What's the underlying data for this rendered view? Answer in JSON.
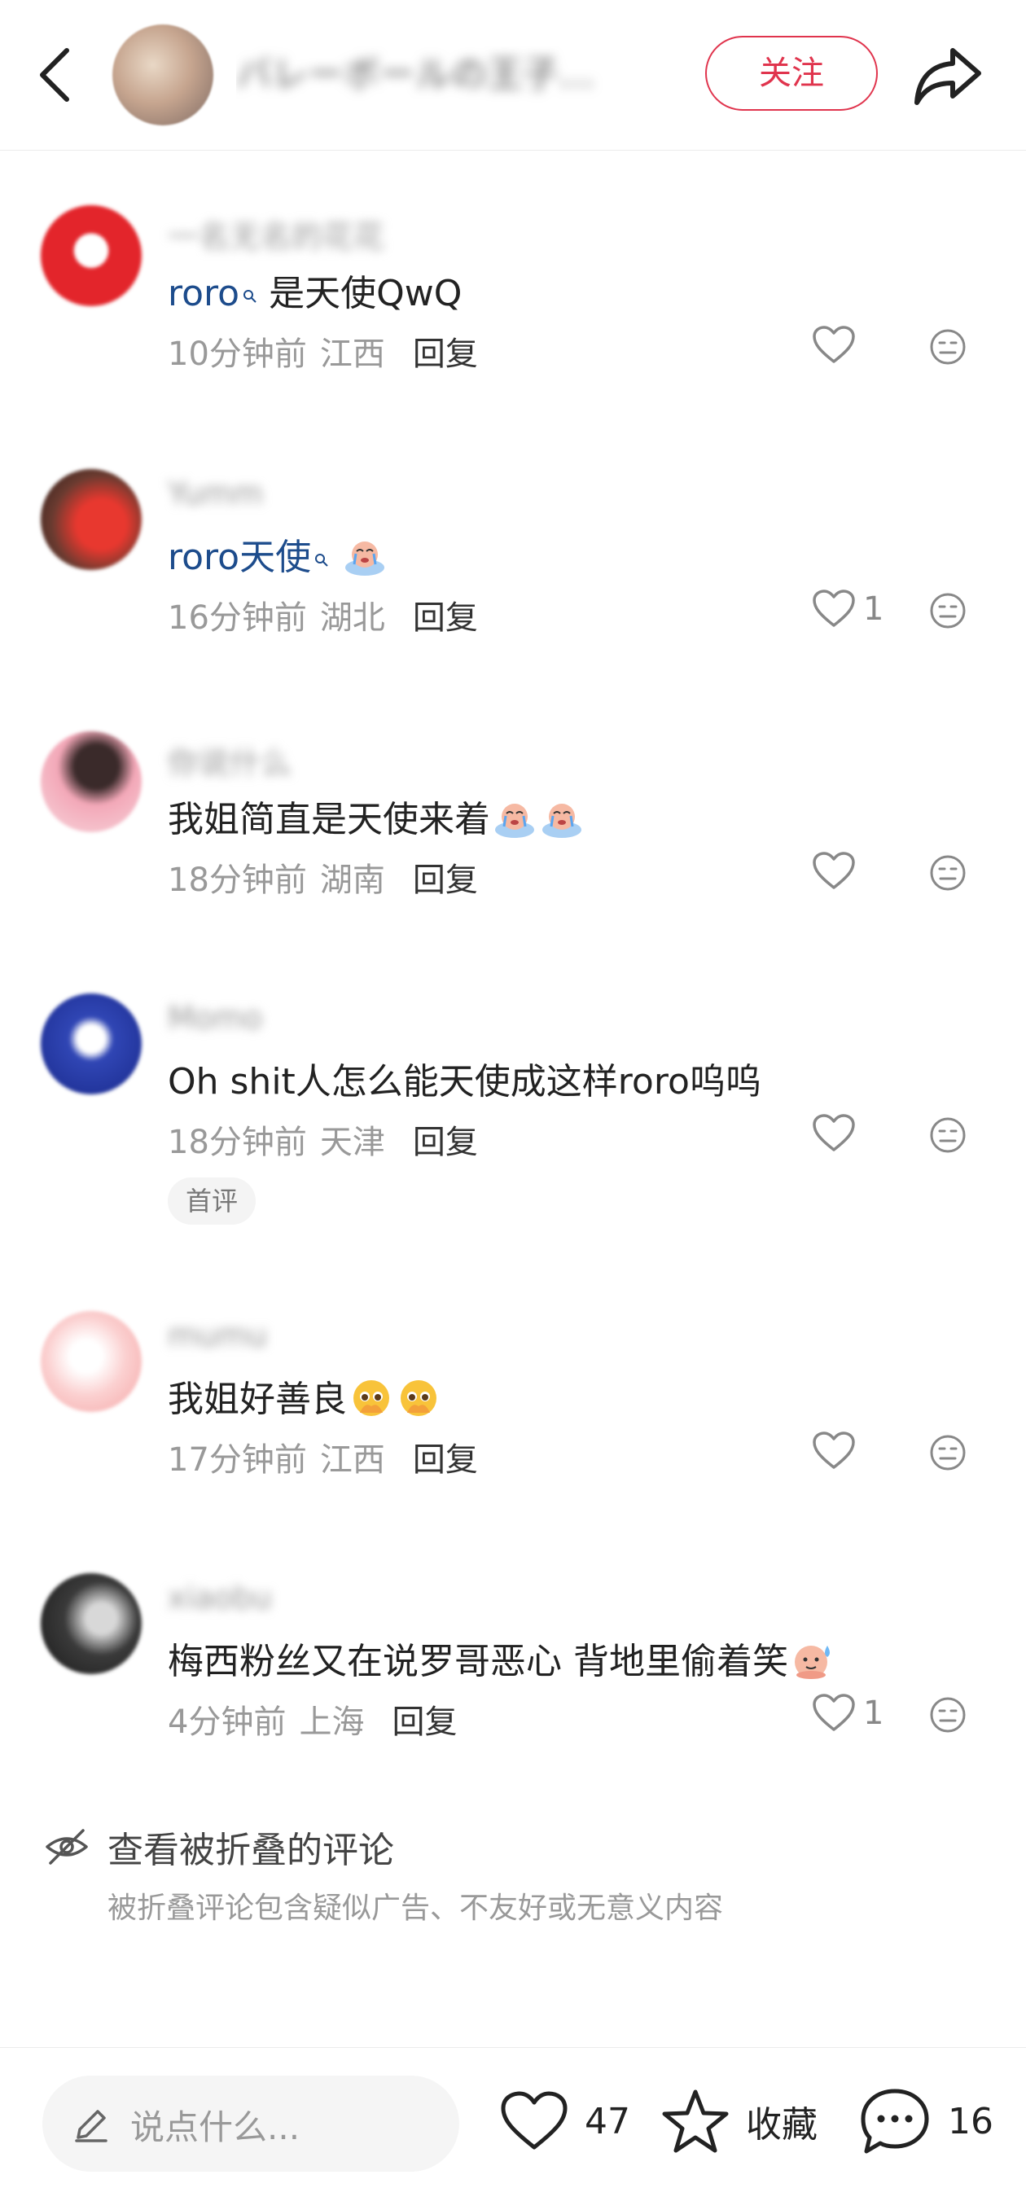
{
  "header": {
    "author_name": "バレーボールの王子…",
    "follow_label": "关注"
  },
  "comments": [
    {
      "username": "一名无名的花花",
      "mention": "roro",
      "text": "是天使QwQ",
      "time": "10分钟前",
      "location": "江西",
      "reply_label": "回复",
      "like_count": "",
      "emojis": []
    },
    {
      "username": "Yumm",
      "mention": "roro天使",
      "text": "",
      "time": "16分钟前",
      "location": "湖北",
      "reply_label": "回复",
      "like_count": "1",
      "emojis": [
        "crying-emoji"
      ]
    },
    {
      "username": "你说什么",
      "mention": "",
      "text": "我姐简直是天使来着",
      "time": "18分钟前",
      "location": "湖南",
      "reply_label": "回复",
      "like_count": "",
      "emojis": [
        "crying-emoji",
        "crying-emoji"
      ]
    },
    {
      "username": "Momo",
      "mention": "",
      "text": "Oh shit人怎么能天使成这样roro呜呜",
      "time": "18分钟前",
      "location": "天津",
      "reply_label": "回复",
      "like_count": "",
      "badge": "首评",
      "emojis": []
    },
    {
      "username": "mumu",
      "mention": "",
      "text": "我姐好善良",
      "time": "17分钟前",
      "location": "江西",
      "reply_label": "回复",
      "like_count": "",
      "emojis": [
        "pleading-face-emoji",
        "pleading-face-emoji"
      ]
    },
    {
      "username": "xiaobu",
      "mention": "",
      "text": "梅西粉丝又在说罗哥恶心 背地里偷着笑",
      "time": "4分钟前",
      "location": "上海",
      "reply_label": "回复",
      "like_count": "1",
      "emojis": [
        "sweat-emoji"
      ]
    }
  ],
  "folded": {
    "title": "查看被折叠的评论",
    "description": "被折叠评论包含疑似广告、不友好或无意义内容"
  },
  "bottom_bar": {
    "input_placeholder": "说点什么...",
    "like_count": "47",
    "collect_label": "收藏",
    "comment_count": "16"
  },
  "colors": {
    "accent": "#e0344d",
    "mention": "#1d4c8c",
    "meta": "#999999"
  }
}
